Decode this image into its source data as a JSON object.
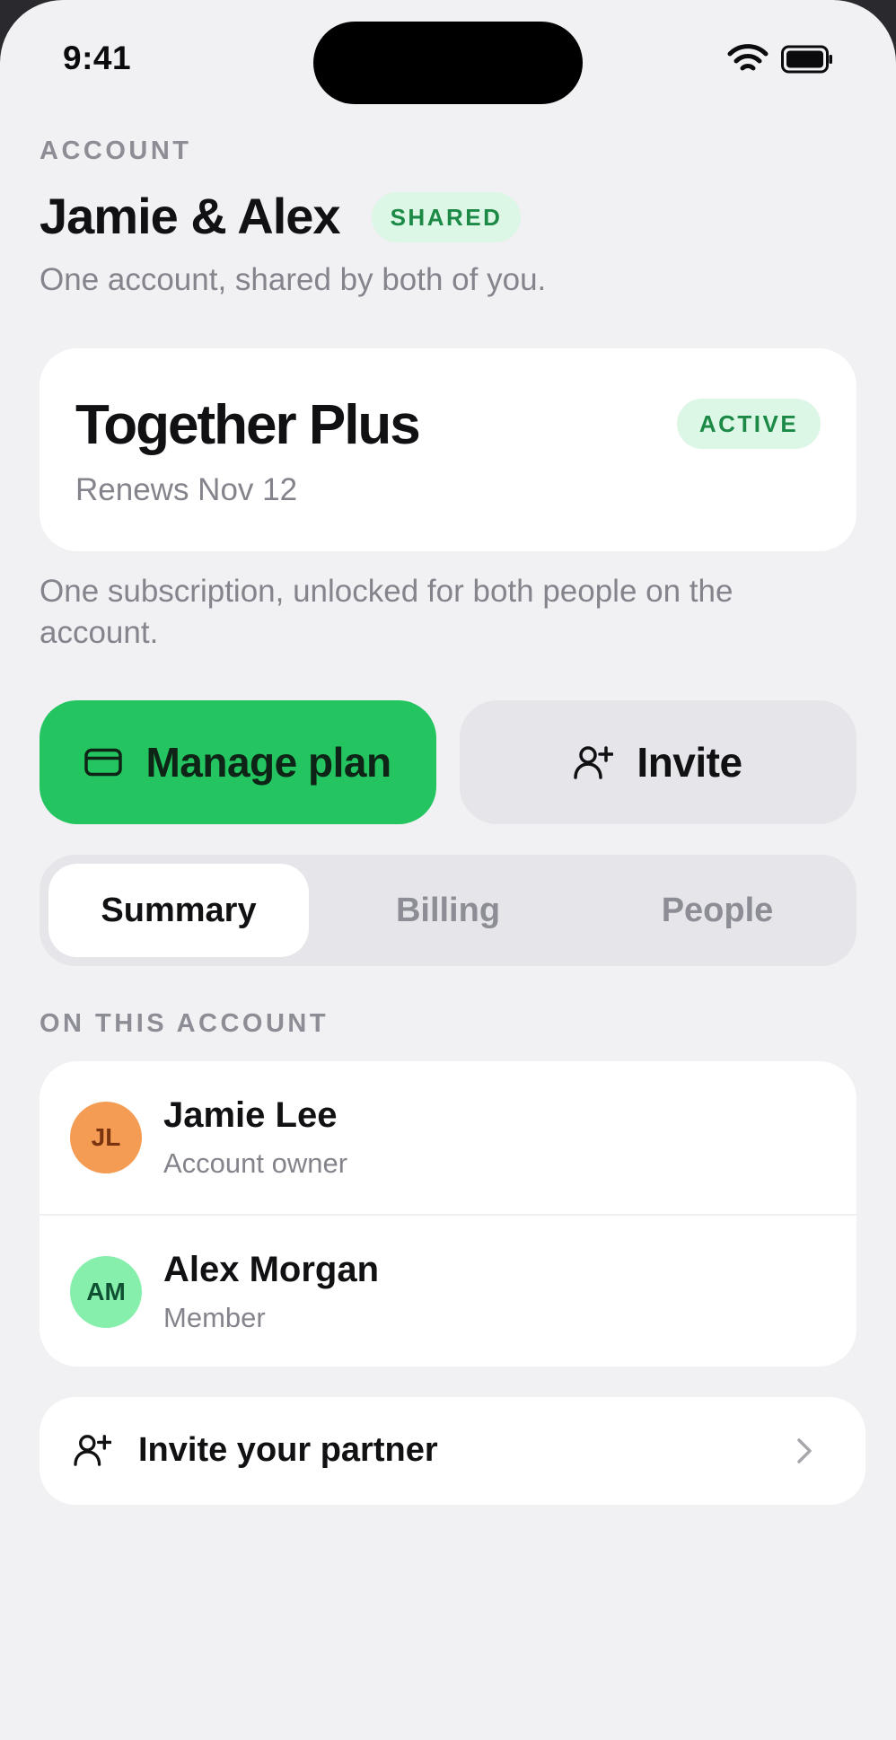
{
  "status_bar": {
    "time": "9:41"
  },
  "header": {
    "eyebrow": "ACCOUNT",
    "title": "Jamie & Alex",
    "badge": "SHARED",
    "subtitle": "One account, shared by both of you."
  },
  "plan": {
    "name": "Together Plus",
    "renews": "Renews Nov 12",
    "status": "ACTIVE",
    "note": "One subscription, unlocked for both people on the account."
  },
  "actions": {
    "manage_label": "Manage plan",
    "invite_label": "Invite"
  },
  "tabs": [
    {
      "label": "Summary",
      "selected": true
    },
    {
      "label": "Billing",
      "selected": false
    },
    {
      "label": "People",
      "selected": false
    }
  ],
  "people": {
    "section_title": "ON THIS ACCOUNT",
    "members": [
      {
        "initials": "JL",
        "name": "Jamie Lee",
        "role": "Account owner"
      },
      {
        "initials": "AM",
        "name": "Alex Morgan",
        "role": "Member"
      }
    ]
  },
  "invite_row": {
    "label": "Invite your partner"
  },
  "icons": {
    "manage": "credit-card-icon",
    "invite": "add-person-icon",
    "chevron": "chevron-right-icon"
  },
  "colors": {
    "accent": "#24c560",
    "badge_bg": "#dcf7e5",
    "badge_text": "#1c8a46",
    "background": "#f1f1f4"
  }
}
